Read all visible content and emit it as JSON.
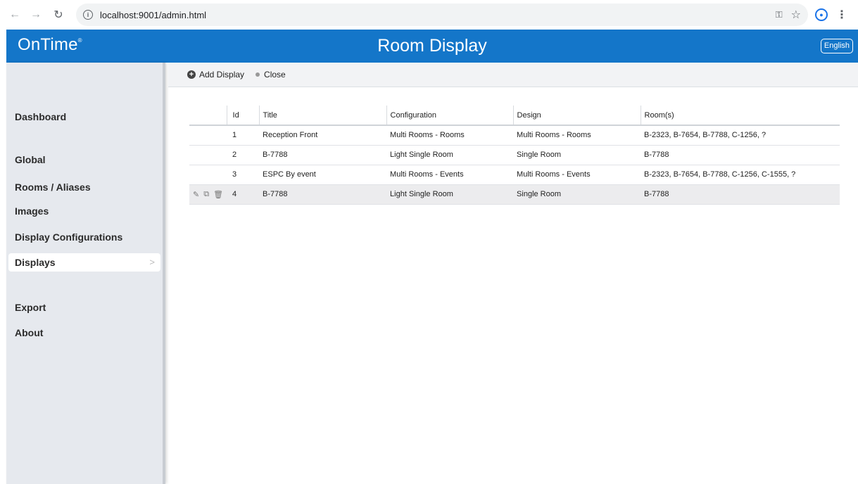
{
  "browser": {
    "url": "localhost:9001/admin.html"
  },
  "header": {
    "logo": "OnTime",
    "logo_mark": "®",
    "title": "Room Display",
    "language": "English"
  },
  "sidebar": {
    "items": [
      {
        "label": "Dashboard"
      },
      {
        "label": "Global"
      },
      {
        "label": "Rooms / Aliases"
      },
      {
        "label": "Images"
      },
      {
        "label": "Display Configurations"
      },
      {
        "label": "Displays"
      },
      {
        "label": "Export"
      },
      {
        "label": "About"
      }
    ],
    "active": "Displays"
  },
  "toolbar": {
    "add_label": "Add Display",
    "close_label": "Close"
  },
  "table": {
    "columns": [
      "Id",
      "Title",
      "Configuration",
      "Design",
      "Room(s)"
    ],
    "rows": [
      {
        "id": "1",
        "title": "Reception Front",
        "configuration": "Multi Rooms - Rooms",
        "design": "Multi Rooms - Rooms",
        "rooms": "B-2323, B-7654, B-7788, C-1256, ?"
      },
      {
        "id": "2",
        "title": "B-7788",
        "configuration": "Light Single Room",
        "design": "Single Room",
        "rooms": "B-7788"
      },
      {
        "id": "3",
        "title": "ESPC By event",
        "configuration": "Multi Rooms - Events",
        "design": "Multi Rooms - Events",
        "rooms": "B-2323, B-7654, B-7788, C-1256, C-1555, ?"
      },
      {
        "id": "4",
        "title": "B-7788",
        "configuration": "Light Single Room",
        "design": "Single Room",
        "rooms": "B-7788"
      }
    ],
    "selected_row": "4"
  },
  "colors": {
    "header_blue": "#1476c9",
    "sidebar_bg": "#e6e9ee",
    "toolbar_bg": "#f2f3f5"
  }
}
